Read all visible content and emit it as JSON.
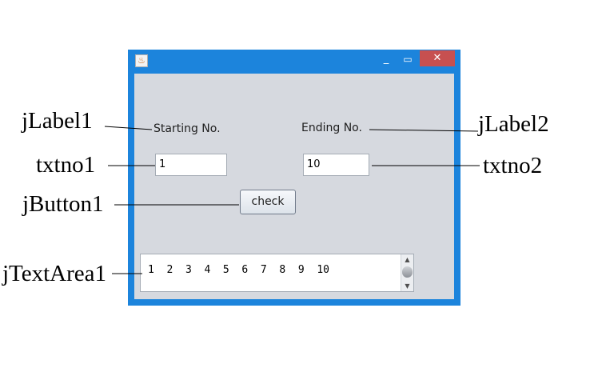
{
  "window": {
    "app_icon": "java-coffee-icon",
    "minimize_glyph": "_",
    "maximize_glyph": "▭",
    "close_glyph": "✕"
  },
  "form": {
    "label1": "Starting No.",
    "label2": "Ending No.",
    "txtno1_value": "1",
    "txtno2_value": "10",
    "button_label": "check",
    "textarea_value": "1  2  3  4  5  6  7  8  9  10"
  },
  "annotations": {
    "jlabel1": "jLabel1",
    "jlabel2": "jLabel2",
    "txtno1": "txtno1",
    "txtno2": "txtno2",
    "jbutton1": "jButton1",
    "jtextarea1": "jTextArea1"
  },
  "colors": {
    "titlebar": "#1c84dc",
    "close_button": "#c75050",
    "panel": "#d6d9df"
  }
}
